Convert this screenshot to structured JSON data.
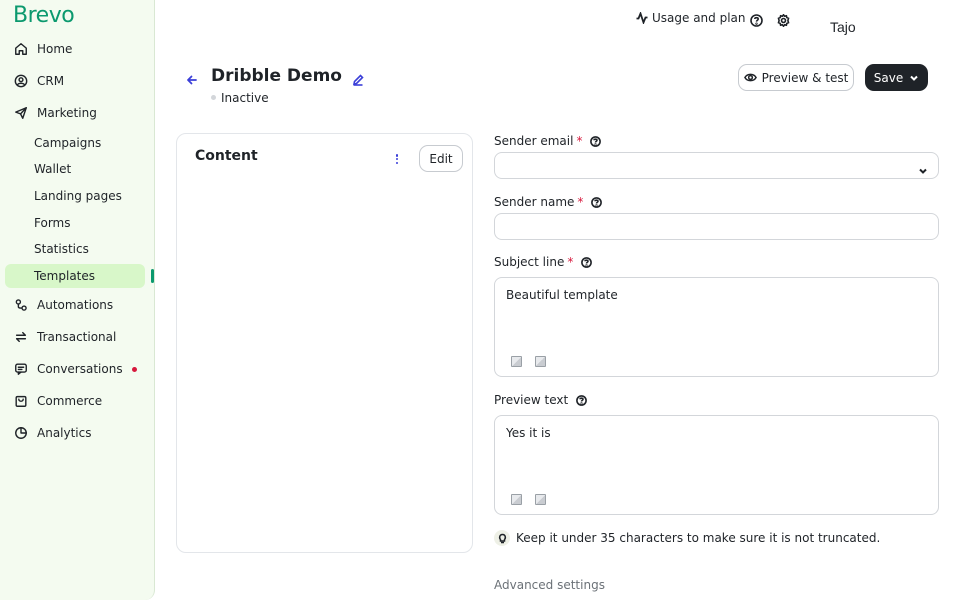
{
  "app": {
    "brand": "Brevo",
    "brand_color": "#0b996e"
  },
  "sidebar": {
    "items": [
      {
        "label": "Home",
        "icon": "home-icon"
      },
      {
        "label": "CRM",
        "icon": "contacts-icon"
      },
      {
        "label": "Marketing",
        "icon": "send-icon"
      },
      {
        "label": "Automations",
        "icon": "automation-icon"
      },
      {
        "label": "Transactional",
        "icon": "swap-icon"
      },
      {
        "label": "Conversations",
        "icon": "chat-icon"
      },
      {
        "label": "Commerce",
        "icon": "bag-icon"
      },
      {
        "label": "Analytics",
        "icon": "pie-chart-icon"
      }
    ],
    "marketing_sub": [
      "Campaigns",
      "Wallet",
      "Landing pages",
      "Forms",
      "Statistics",
      "Templates"
    ],
    "active_sub": "Templates"
  },
  "topbar": {
    "usage_label": "Usage and plan",
    "user_name": "Tajo"
  },
  "header": {
    "title": "Dribble Demo",
    "status": "Inactive",
    "preview_label": "Preview & test",
    "save_label": "Save"
  },
  "content_card": {
    "title": "Content",
    "edit_label": "Edit"
  },
  "form": {
    "sender_email": {
      "label": "Sender email",
      "required": "*",
      "value": ""
    },
    "sender_name": {
      "label": "Sender name",
      "required": "*",
      "value": ""
    },
    "subject_line": {
      "label": "Subject line",
      "required": "*",
      "value": "Beautiful template"
    },
    "preview_text": {
      "label": "Preview text",
      "value": "Yes it is"
    },
    "hint": "Keep it under 35 characters to make sure it is not truncated.",
    "advanced_label": "Advanced settings"
  }
}
